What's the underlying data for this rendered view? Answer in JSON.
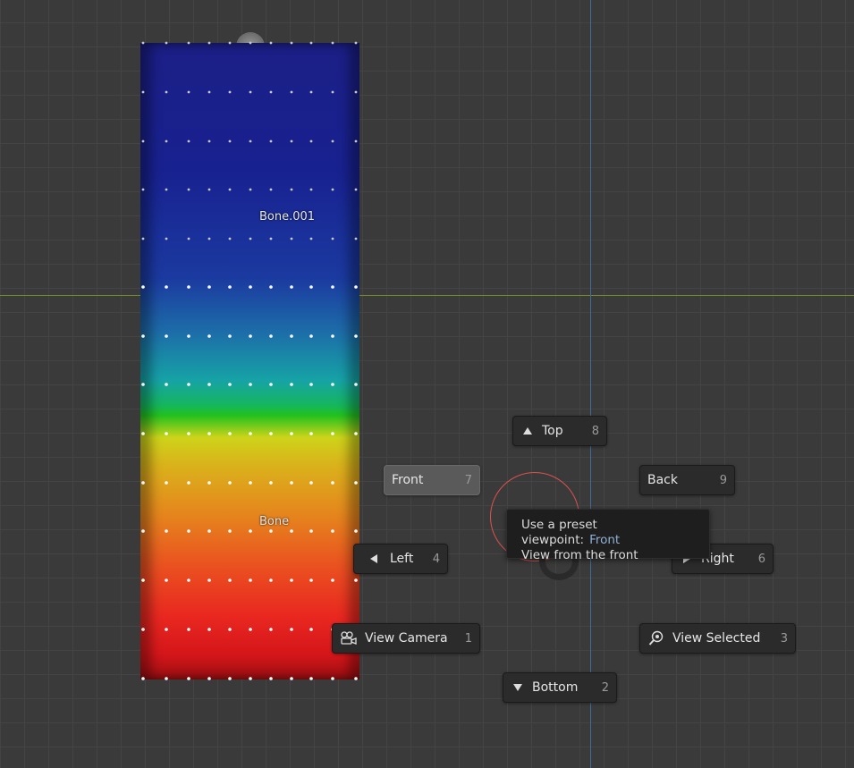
{
  "viewport": {
    "colors": {
      "background": "#3a3a3a",
      "x_axis": "#6e8a2a",
      "y_axis": "#3f6a9a"
    }
  },
  "armature": {
    "bone_upper": "Bone.001",
    "bone_lower": "Bone"
  },
  "pie_menu": {
    "items": [
      {
        "id": "top",
        "label": "Top",
        "key": "8",
        "icon": "triangle-up-icon"
      },
      {
        "id": "front",
        "label": "Front",
        "key": "7",
        "icon": "",
        "active": true
      },
      {
        "id": "back",
        "label": "Back",
        "key": "9",
        "icon": ""
      },
      {
        "id": "left",
        "label": "Left",
        "key": "4",
        "icon": "triangle-left-icon"
      },
      {
        "id": "right",
        "label": "Right",
        "key": "6",
        "icon": "triangle-right-icon"
      },
      {
        "id": "view_camera",
        "label": "View Camera",
        "key": "1",
        "icon": "camera-icon"
      },
      {
        "id": "view_selected",
        "label": "View Selected",
        "key": "3",
        "icon": "zoom-selected-icon"
      },
      {
        "id": "bottom",
        "label": "Bottom",
        "key": "2",
        "icon": "triangle-down-icon"
      }
    ]
  },
  "tooltip": {
    "title": "Use a preset viewpoint:",
    "value": "Front",
    "description": "View from the front"
  }
}
